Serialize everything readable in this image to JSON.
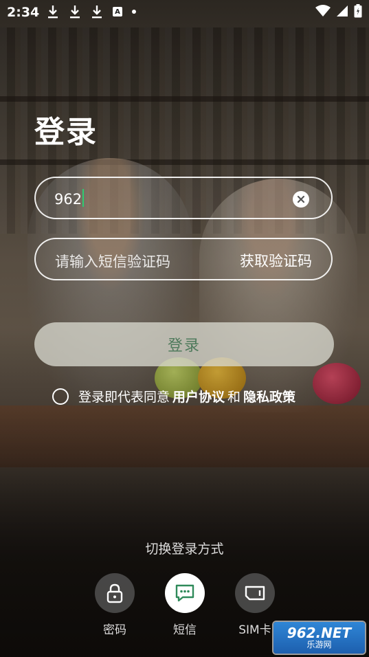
{
  "status_bar": {
    "time": "2:34",
    "icons": [
      "download-icon",
      "download-icon",
      "download-icon",
      "font-icon",
      "dot-icon",
      "wifi-icon",
      "signal-icon",
      "battery-icon"
    ],
    "font_icon_letter": "A"
  },
  "page": {
    "title": "登录"
  },
  "phone_field": {
    "value": "962"
  },
  "code_field": {
    "placeholder": "请输入短信验证码",
    "get_code_label": "获取验证码"
  },
  "login_button": {
    "label": "登录"
  },
  "agreement": {
    "prefix": "登录即代表同意",
    "user_agreement": "用户协议",
    "and": "和",
    "privacy_policy": "隐私政策"
  },
  "switch_methods": {
    "label": "切换登录方式",
    "items": [
      {
        "label": "密码",
        "icon": "lock-icon",
        "active": false
      },
      {
        "label": "短信",
        "icon": "message-icon",
        "active": true
      },
      {
        "label": "SIM卡",
        "icon": "sim-card-icon",
        "active": false
      }
    ]
  },
  "watermark": {
    "top": "962.NET",
    "bottom": "乐游网"
  },
  "colors": {
    "accent_green": "#2ecc71",
    "login_text": "#4f7a5c"
  }
}
